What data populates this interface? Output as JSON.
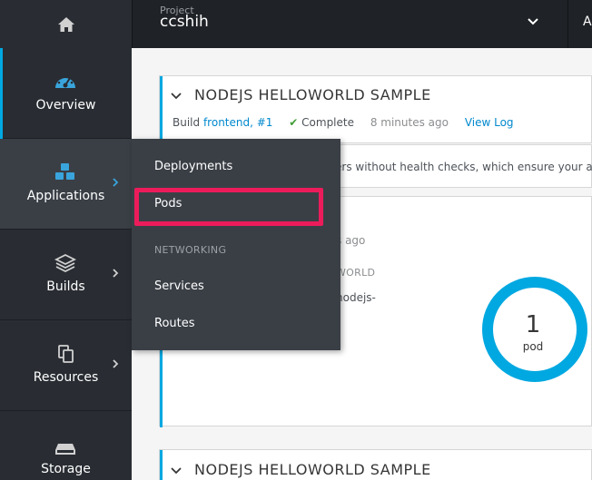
{
  "topbar": {
    "project_label": "Project",
    "project_name": "ccshih",
    "right_label": "A"
  },
  "sidebar": {
    "items": [
      {
        "label": "Overview",
        "icon": "dashboard-icon"
      },
      {
        "label": "Applications",
        "icon": "cubes-icon"
      },
      {
        "label": "Builds",
        "icon": "layers-icon"
      },
      {
        "label": "Resources",
        "icon": "copy-icon"
      },
      {
        "label": "Storage",
        "icon": "hdd-icon"
      }
    ]
  },
  "flyout": {
    "deployments": "Deployments",
    "pods": "Pods",
    "networking_heading": "NETWORKING",
    "services": "Services",
    "routes": "Routes"
  },
  "main": {
    "card1": {
      "title": "NODEJS HELLOWORLD SAMPLE",
      "build_prefix": "Build",
      "build_link": "frontend, #1",
      "status": "Complete",
      "time": "8 minutes ago",
      "view_log": "View Log"
    },
    "warning_text": "ers without health checks, which ensure your ap",
    "ago_text": "s ago",
    "world_text": "WORLD",
    "nodejs_text": "nodejs-",
    "pods": {
      "count": "1",
      "label": "pod"
    },
    "card3": {
      "title": "NODEJS HELLOWORLD SAMPLE"
    }
  },
  "colors": {
    "accent": "#00a8e1",
    "highlight": "#ec1c5b",
    "success": "#3f9c35",
    "link": "#0088ce"
  }
}
